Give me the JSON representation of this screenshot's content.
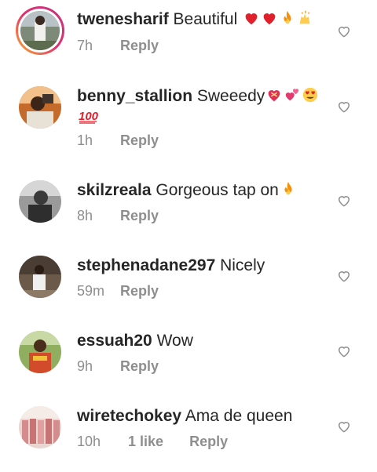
{
  "comments": [
    {
      "username": "twenesharif",
      "text": "Beautiful",
      "emojis": [
        "red-heart",
        "red-heart",
        "fire",
        "raising-hands"
      ],
      "time": "7h",
      "likes": "",
      "reply_label": "Reply",
      "has_story_ring": true
    },
    {
      "username": "benny_stallion",
      "text": "Sweeedy",
      "emojis": [
        "heart-with-ribbon",
        "two-hearts",
        "heart-eyes",
        "hundred-points"
      ],
      "time": "1h",
      "likes": "",
      "reply_label": "Reply",
      "has_story_ring": false
    },
    {
      "username": "skilzreala",
      "text": "Gorgeous tap on",
      "emojis": [
        "fire"
      ],
      "time": "8h",
      "likes": "",
      "reply_label": "Reply",
      "has_story_ring": false
    },
    {
      "username": "stephenadane297",
      "text": "Nicely",
      "emojis": [],
      "time": "59m",
      "likes": "",
      "reply_label": "Reply",
      "has_story_ring": false
    },
    {
      "username": "essuah20",
      "text": "Wow",
      "emojis": [],
      "time": "9h",
      "likes": "",
      "reply_label": "Reply",
      "has_story_ring": false
    },
    {
      "username": "wiretechokey",
      "text": "Ama de queen",
      "emojis": [],
      "time": "10h",
      "likes": "1 like",
      "reply_label": "Reply",
      "has_story_ring": false
    }
  ],
  "icons": {
    "like": "heart-outline-icon"
  },
  "colors": {
    "text": "#262626",
    "meta": "#8e8e8e",
    "heart_outline": "#8e8e8e"
  }
}
